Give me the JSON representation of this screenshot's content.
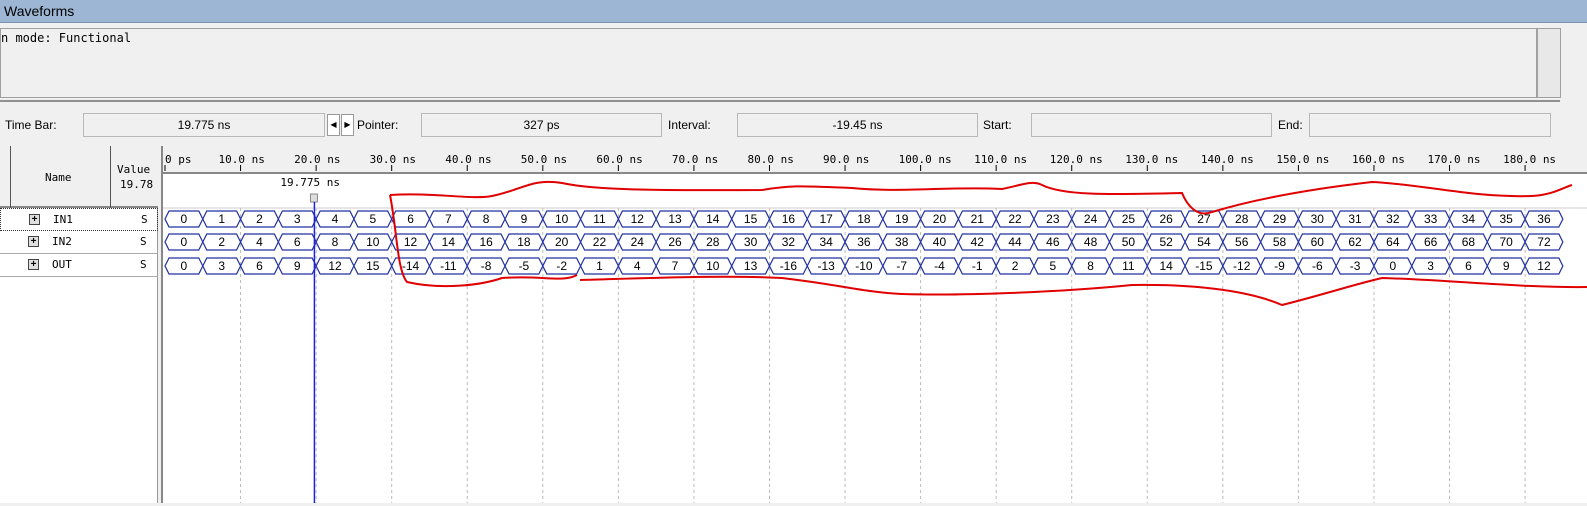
{
  "window": {
    "title": "Waveforms"
  },
  "messages": {
    "line": "n mode: Functional"
  },
  "toolbar": {
    "time_bar_label": "Time Bar:",
    "time_bar_value": "19.775 ns",
    "pointer_label": "Pointer:",
    "pointer_value": "327 ps",
    "interval_label": "Interval:",
    "interval_value": "-19.45 ns",
    "start_label": "Start:",
    "start_value": "",
    "end_label": "End:",
    "end_value": ""
  },
  "signals": {
    "name_header": "Name",
    "value_header": "Value",
    "value_time": "19.78",
    "rows": [
      {
        "name": "IN1",
        "value": "S"
      },
      {
        "name": "IN2",
        "value": "S"
      },
      {
        "name": "OUT",
        "value": "S"
      }
    ]
  },
  "timeline": {
    "ticks": [
      "0 ps",
      "10.0 ns",
      "20.0 ns",
      "30.0 ns",
      "40.0 ns",
      "50.0 ns",
      "60.0 ns",
      "70.0 ns",
      "80.0 ns",
      "90.0 ns",
      "100.0 ns",
      "110.0 ns",
      "120.0 ns",
      "130.0 ns",
      "140.0 ns",
      "150.0 ns",
      "160.0 ns",
      "170.0 ns",
      "180.0 ns"
    ],
    "cursor_label": "19.775 ns",
    "cursor_ns": 19.775,
    "segment_ns": 5
  },
  "buses": {
    "IN1": [
      "0",
      "1",
      "2",
      "3",
      "4",
      "5",
      "6",
      "7",
      "8",
      "9",
      "10",
      "11",
      "12",
      "13",
      "14",
      "15",
      "16",
      "17",
      "18",
      "19",
      "20",
      "21",
      "22",
      "23",
      "24",
      "25",
      "26",
      "27",
      "28",
      "29",
      "30",
      "31",
      "32",
      "33",
      "34",
      "35",
      "36"
    ],
    "IN2": [
      "0",
      "2",
      "4",
      "6",
      "8",
      "10",
      "12",
      "14",
      "16",
      "18",
      "20",
      "22",
      "24",
      "26",
      "28",
      "30",
      "32",
      "34",
      "36",
      "38",
      "40",
      "42",
      "44",
      "46",
      "48",
      "50",
      "52",
      "54",
      "56",
      "58",
      "60",
      "62",
      "64",
      "66",
      "68",
      "70",
      "72"
    ],
    "OUT": [
      "0",
      "3",
      "6",
      "9",
      "12",
      "15",
      "-14",
      "-11",
      "-8",
      "-5",
      "-2",
      "1",
      "4",
      "7",
      "10",
      "13",
      "-16",
      "-13",
      "-10",
      "-7",
      "-4",
      "-1",
      "2",
      "5",
      "8",
      "11",
      "14",
      "-15",
      "-12",
      "-9",
      "-6",
      "-3",
      "0",
      "3",
      "6",
      "9",
      "12"
    ]
  },
  "colors": {
    "bus": "#2030a0",
    "cursor": "#2020e0",
    "annotation": "#e00000",
    "titlebar": "#9cb6d4"
  }
}
